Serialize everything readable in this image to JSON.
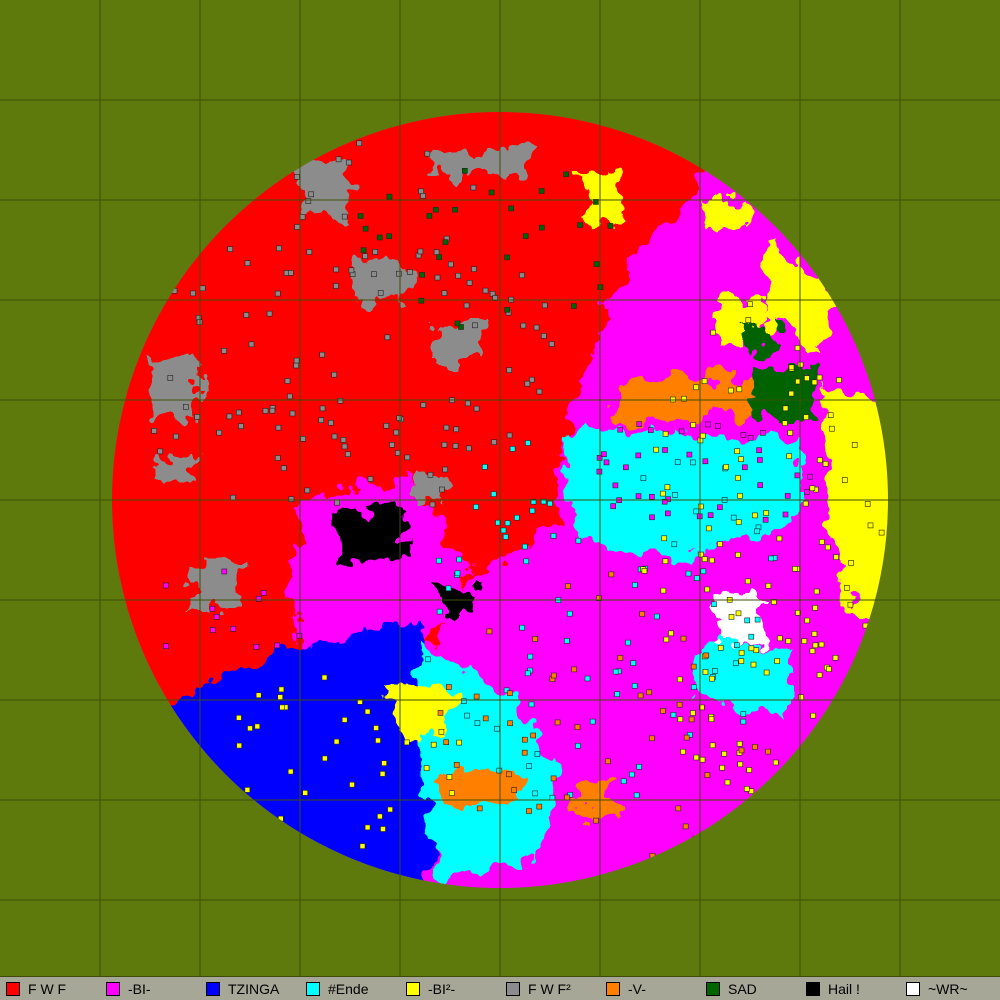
{
  "map": {
    "background": "#5f7a0c",
    "grid_color": "#3c4f07",
    "grid_columns": 10,
    "grid_rows": 10
  },
  "factions": [
    {
      "name": "F W F",
      "color": "#ff0000"
    },
    {
      "name": "-BI-",
      "color": "#ff00ff"
    },
    {
      "name": "TZINGA",
      "color": "#0000ff"
    },
    {
      "name": "#Ende",
      "color": "#00ffff"
    },
    {
      "name": "-BI²-",
      "color": "#ffff00"
    },
    {
      "name": "F W F²",
      "color": "#8c8c8c"
    },
    {
      "name": "-V-",
      "color": "#ff8000"
    },
    {
      "name": "SAD",
      "color": "#006400"
    },
    {
      "name": "Hail !",
      "color": "#000000"
    },
    {
      "name": "~WR~",
      "color": "#ffffff"
    }
  ]
}
